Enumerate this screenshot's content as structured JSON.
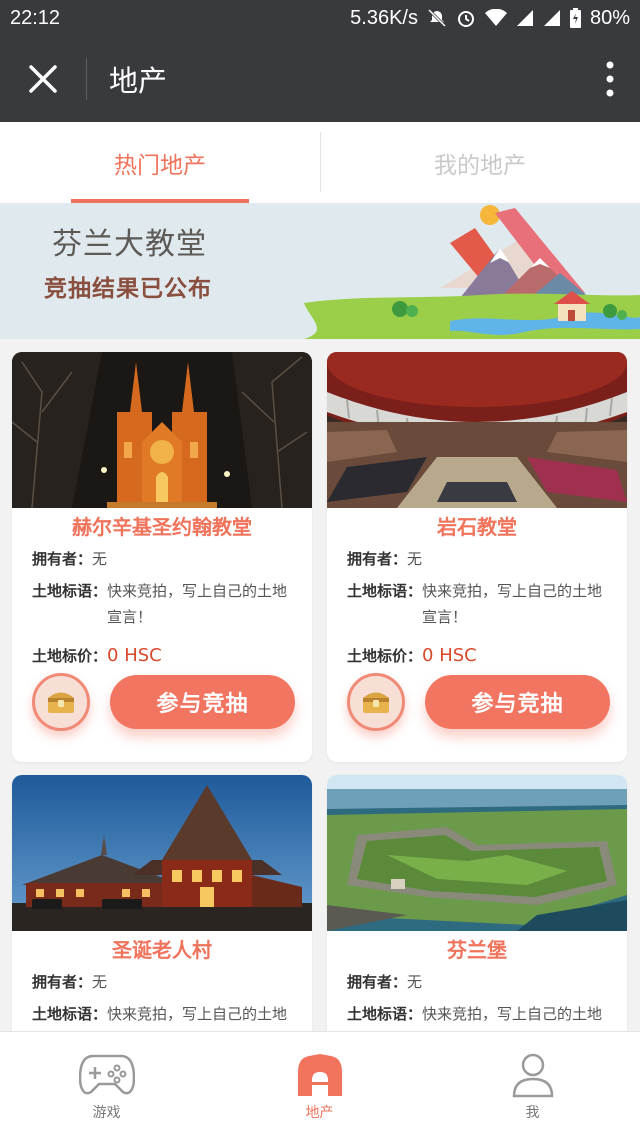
{
  "status_bar": {
    "time": "22:12",
    "net_speed": "5.36K/s",
    "battery": "80%"
  },
  "header": {
    "title": "地产"
  },
  "tabs": [
    {
      "label": "热门地产",
      "active": true
    },
    {
      "label": "我的地产",
      "active": false
    }
  ],
  "banner": {
    "title": "芬兰大教堂",
    "subtitle": "竞抽结果已公布"
  },
  "labels": {
    "owner": "拥有者：",
    "slogan": "土地标语：",
    "price": "土地标价：",
    "bid_button": "参与竞抽"
  },
  "cards": [
    {
      "name": "赫尔辛基圣约翰教堂",
      "owner": "无",
      "slogan": "快来竞拍，写上自己的土地宣言！",
      "price": "0 HSC"
    },
    {
      "name": "岩石教堂",
      "owner": "无",
      "slogan": "快来竞拍，写上自己的土地宣言！",
      "price": "0 HSC"
    },
    {
      "name": "圣诞老人村",
      "owner": "无",
      "slogan": "快来竞拍，写上自己的土地宣言！"
    },
    {
      "name": "芬兰堡",
      "owner": "无",
      "slogan": "快来竞拍，写上自己的土地宣言！"
    }
  ],
  "bottom_nav": [
    {
      "label": "游戏",
      "icon": "gamepad-icon",
      "active": false
    },
    {
      "label": "地产",
      "icon": "house-icon",
      "active": true
    },
    {
      "label": "我",
      "icon": "user-icon",
      "active": false
    }
  ],
  "colors": {
    "accent": "#f0735b",
    "header_bg": "#393a3e",
    "price": "#d94a2b",
    "bid_button": "#f27561"
  }
}
